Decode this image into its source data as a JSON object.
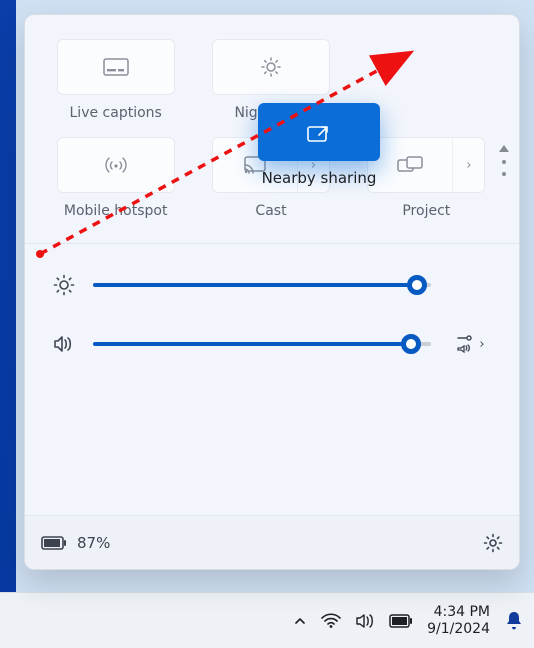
{
  "tiles": {
    "live_captions": "Live captions",
    "night_light": "Night light",
    "nearby_sharing": "Nearby sharing",
    "mobile_hotspot": "Mobile hotspot",
    "cast": "Cast",
    "project": "Project"
  },
  "sliders": {
    "brightness_pct": 96,
    "volume_pct": 94
  },
  "footer": {
    "battery_pct": "87%"
  },
  "taskbar": {
    "time": "4:34 PM",
    "date": "9/1/2024"
  },
  "colors": {
    "accent": "#0a6dd8",
    "slider": "#065ac2"
  }
}
